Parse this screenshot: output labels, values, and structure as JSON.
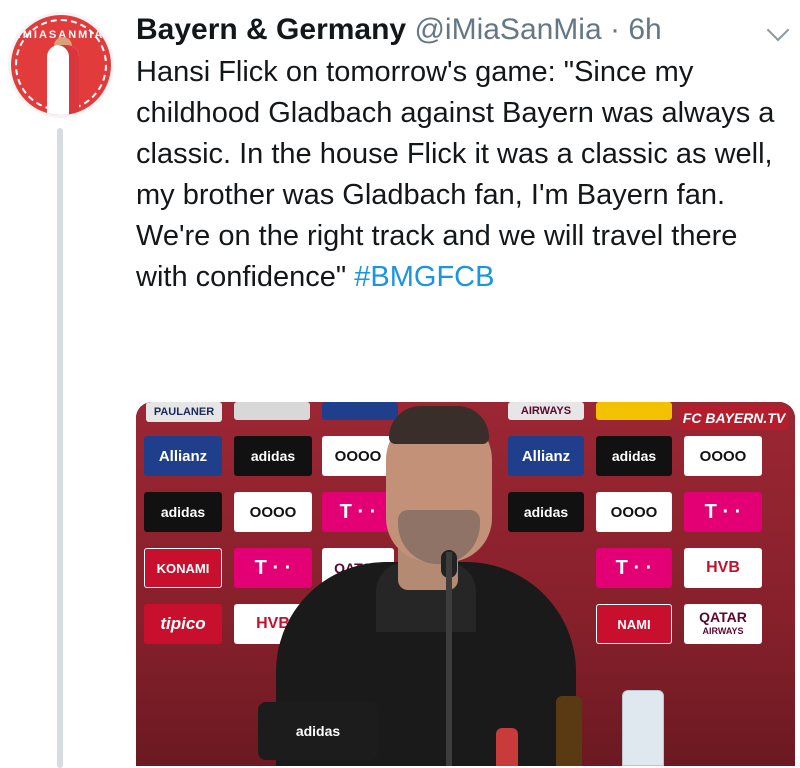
{
  "tweet": {
    "author_name": "Bayern & Germany",
    "handle": "@iMiaSanMia",
    "separator": "·",
    "time": "6h",
    "text": "Hansi Flick on tomorrow's game: \"Since my childhood Gladbach against Bayern was always a classic. In the house Flick it was a classic as well, my brother was Gladbach fan, I'm Bayern fan. We're on the right track and we will travel there with confidence\" ",
    "hashtag": "#BMGFCB"
  },
  "avatar": {
    "badge_text": "IMIASANMIA"
  },
  "media": {
    "sponsors": {
      "paulaner": "PAULANER",
      "airways": "AIRWAYS",
      "fcbtv": "FC BAYERN.TV",
      "allianz": "Allianz",
      "adidas": "adidas",
      "audi": "OOOO",
      "telekom": "T · ·",
      "konami": "KONAMI",
      "tipico": "tipico",
      "hvb": "HVB",
      "qatar": "QATAR",
      "qatar_sub": "AIRWAYS",
      "nami": "NAMI",
      "desk_sign": "adidas"
    }
  },
  "colors": {
    "hashtag": "#1b95e0",
    "handle": "#657786",
    "thread_line": "#d6dce0"
  },
  "icons": {
    "menu": "chevron-down-icon"
  }
}
